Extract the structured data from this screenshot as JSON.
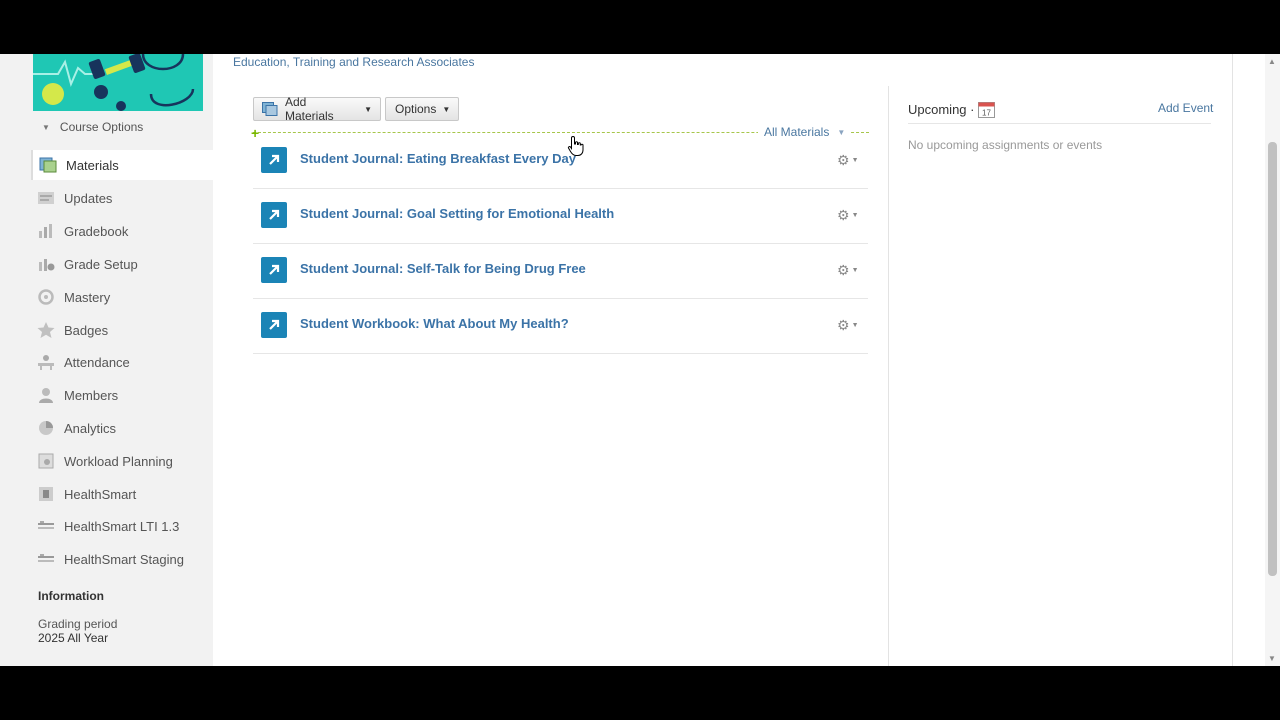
{
  "sidebar": {
    "course_options_label": "Course Options",
    "items": [
      {
        "label": "Materials",
        "icon": "materials-icon",
        "active": true
      },
      {
        "label": "Updates",
        "icon": "updates-icon"
      },
      {
        "label": "Gradebook",
        "icon": "gradebook-icon"
      },
      {
        "label": "Grade Setup",
        "icon": "grade-setup-icon"
      },
      {
        "label": "Mastery",
        "icon": "mastery-icon"
      },
      {
        "label": "Badges",
        "icon": "badges-icon"
      },
      {
        "label": "Attendance",
        "icon": "attendance-icon"
      },
      {
        "label": "Members",
        "icon": "members-icon"
      },
      {
        "label": "Analytics",
        "icon": "analytics-icon"
      },
      {
        "label": "Workload Planning",
        "icon": "workload-icon"
      },
      {
        "label": "HealthSmart",
        "icon": "app-icon"
      },
      {
        "label": "HealthSmart LTI 1.3",
        "icon": "lti-app-icon"
      },
      {
        "label": "HealthSmart Staging",
        "icon": "lti-app-icon"
      }
    ],
    "information_title": "Information",
    "grading_period_label": "Grading period",
    "grading_period_value": "2025 All Year"
  },
  "main": {
    "subtitle": "Education, Training and Research Associates",
    "add_materials_label": "Add Materials",
    "options_label": "Options",
    "all_materials_label": "All Materials",
    "materials": [
      {
        "title": "Student Journal: Eating Breakfast Every Day"
      },
      {
        "title": "Student Journal: Goal Setting for Emotional Health"
      },
      {
        "title": "Student Journal: Self-Talk for Being Drug Free"
      },
      {
        "title": "Student Workbook: What About My Health?"
      }
    ]
  },
  "upcoming": {
    "title": "Upcoming ·",
    "calendar_icon_text": "17",
    "add_event_label": "Add Event",
    "empty_text": "No upcoming assignments or events"
  },
  "colors": {
    "link": "#3b73a7",
    "material_icon_bg": "#1b84b6",
    "divider": "#a6c64a",
    "banner": "#1fc7b4"
  }
}
